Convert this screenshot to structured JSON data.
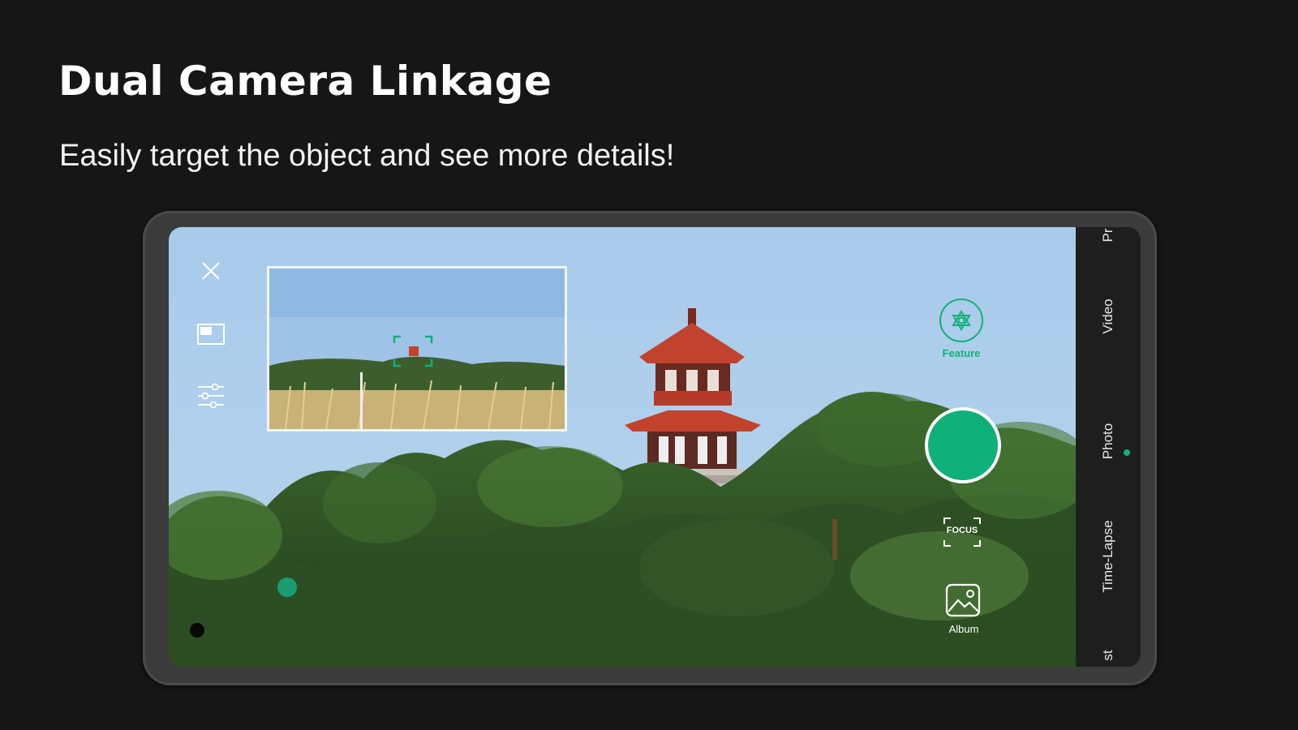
{
  "headline": "Dual Camera Linkage",
  "subline": "Easily target the object and see more details!",
  "camera": {
    "feature_label": "Feature",
    "focus_label": "FOCUS",
    "album_label": "Album",
    "modes": [
      "Pr",
      "Video",
      "Photo",
      "Time-Lapse",
      "st"
    ],
    "active_mode": "Photo",
    "icons": {
      "close": "close-icon",
      "pip": "picture-in-picture-icon",
      "settings": "sliders-icon",
      "feature": "gear-icon",
      "album": "gallery-icon"
    },
    "colors": {
      "accent": "#13b07b",
      "sky": "#a9cbe8",
      "frame": "#3b3b3b"
    }
  }
}
